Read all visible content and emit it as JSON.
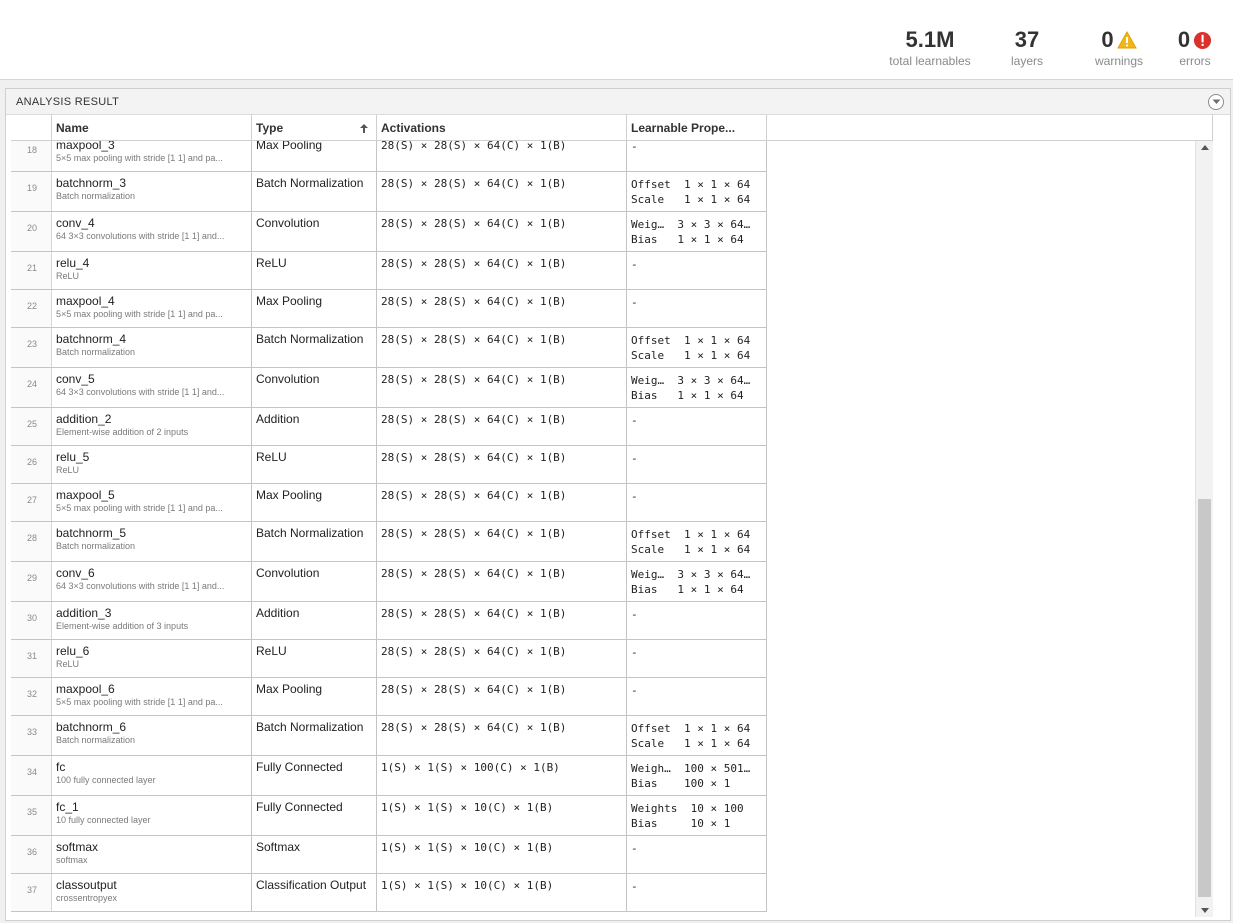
{
  "summary": {
    "total_learnables_value": "5.1M",
    "total_learnables_label": "total learnables",
    "layers_value": "37",
    "layers_label": "layers",
    "warnings_value": "0",
    "warnings_label": "warnings",
    "errors_value": "0",
    "errors_label": "errors"
  },
  "panel": {
    "title": "ANALYSIS RESULT"
  },
  "table": {
    "columns": {
      "name": "Name",
      "type": "Type",
      "activations": "Activations",
      "learnables": "Learnable Prope..."
    },
    "scroll_position": 0.47,
    "rows": [
      {
        "idx": "18",
        "name": "maxpool_3",
        "desc": "5×5 max pooling with stride [1 1] and pa...",
        "type": "Max Pooling",
        "act": "28(S) × 28(S) × 64(C) × 1(B)",
        "learn": "-"
      },
      {
        "idx": "19",
        "name": "batchnorm_3",
        "desc": "Batch normalization",
        "type": "Batch Normalization",
        "act": "28(S) × 28(S) × 64(C) × 1(B)",
        "learn": "Offset  1 × 1 × 64\nScale   1 × 1 × 64"
      },
      {
        "idx": "20",
        "name": "conv_4",
        "desc": "64 3×3 convolutions with stride [1 1] and...",
        "type": "Convolution",
        "act": "28(S) × 28(S) × 64(C) × 1(B)",
        "learn": "Weig…  3 × 3 × 64…\nBias   1 × 1 × 64"
      },
      {
        "idx": "21",
        "name": "relu_4",
        "desc": "ReLU",
        "type": "ReLU",
        "act": "28(S) × 28(S) × 64(C) × 1(B)",
        "learn": "-"
      },
      {
        "idx": "22",
        "name": "maxpool_4",
        "desc": "5×5 max pooling with stride [1 1] and pa...",
        "type": "Max Pooling",
        "act": "28(S) × 28(S) × 64(C) × 1(B)",
        "learn": "-"
      },
      {
        "idx": "23",
        "name": "batchnorm_4",
        "desc": "Batch normalization",
        "type": "Batch Normalization",
        "act": "28(S) × 28(S) × 64(C) × 1(B)",
        "learn": "Offset  1 × 1 × 64\nScale   1 × 1 × 64"
      },
      {
        "idx": "24",
        "name": "conv_5",
        "desc": "64 3×3 convolutions with stride [1 1] and...",
        "type": "Convolution",
        "act": "28(S) × 28(S) × 64(C) × 1(B)",
        "learn": "Weig…  3 × 3 × 64…\nBias   1 × 1 × 64"
      },
      {
        "idx": "25",
        "name": "addition_2",
        "desc": "Element-wise addition of 2 inputs",
        "type": "Addition",
        "act": "28(S) × 28(S) × 64(C) × 1(B)",
        "learn": "-"
      },
      {
        "idx": "26",
        "name": "relu_5",
        "desc": "ReLU",
        "type": "ReLU",
        "act": "28(S) × 28(S) × 64(C) × 1(B)",
        "learn": "-"
      },
      {
        "idx": "27",
        "name": "maxpool_5",
        "desc": "5×5 max pooling with stride [1 1] and pa...",
        "type": "Max Pooling",
        "act": "28(S) × 28(S) × 64(C) × 1(B)",
        "learn": "-"
      },
      {
        "idx": "28",
        "name": "batchnorm_5",
        "desc": "Batch normalization",
        "type": "Batch Normalization",
        "act": "28(S) × 28(S) × 64(C) × 1(B)",
        "learn": "Offset  1 × 1 × 64\nScale   1 × 1 × 64"
      },
      {
        "idx": "29",
        "name": "conv_6",
        "desc": "64 3×3 convolutions with stride [1 1] and...",
        "type": "Convolution",
        "act": "28(S) × 28(S) × 64(C) × 1(B)",
        "learn": "Weig…  3 × 3 × 64…\nBias   1 × 1 × 64"
      },
      {
        "idx": "30",
        "name": "addition_3",
        "desc": "Element-wise addition of 3 inputs",
        "type": "Addition",
        "act": "28(S) × 28(S) × 64(C) × 1(B)",
        "learn": "-"
      },
      {
        "idx": "31",
        "name": "relu_6",
        "desc": "ReLU",
        "type": "ReLU",
        "act": "28(S) × 28(S) × 64(C) × 1(B)",
        "learn": "-"
      },
      {
        "idx": "32",
        "name": "maxpool_6",
        "desc": "5×5 max pooling with stride [1 1] and pa...",
        "type": "Max Pooling",
        "act": "28(S) × 28(S) × 64(C) × 1(B)",
        "learn": "-"
      },
      {
        "idx": "33",
        "name": "batchnorm_6",
        "desc": "Batch normalization",
        "type": "Batch Normalization",
        "act": "28(S) × 28(S) × 64(C) × 1(B)",
        "learn": "Offset  1 × 1 × 64\nScale   1 × 1 × 64"
      },
      {
        "idx": "34",
        "name": "fc",
        "desc": "100 fully connected layer",
        "type": "Fully Connected",
        "act": "1(S) × 1(S) × 100(C) × 1(B)",
        "learn": "Weigh…  100 × 501…\nBias    100 × 1"
      },
      {
        "idx": "35",
        "name": "fc_1",
        "desc": "10 fully connected layer",
        "type": "Fully Connected",
        "act": "1(S) × 1(S) × 10(C) × 1(B)",
        "learn": "Weights  10 × 100\nBias     10 × 1"
      },
      {
        "idx": "36",
        "name": "softmax",
        "desc": "softmax",
        "type": "Softmax",
        "act": "1(S) × 1(S) × 10(C) × 1(B)",
        "learn": "-"
      },
      {
        "idx": "37",
        "name": "classoutput",
        "desc": "crossentropyex",
        "type": "Classification Output",
        "act": "1(S) × 1(S) × 10(C) × 1(B)",
        "learn": "-"
      }
    ]
  }
}
